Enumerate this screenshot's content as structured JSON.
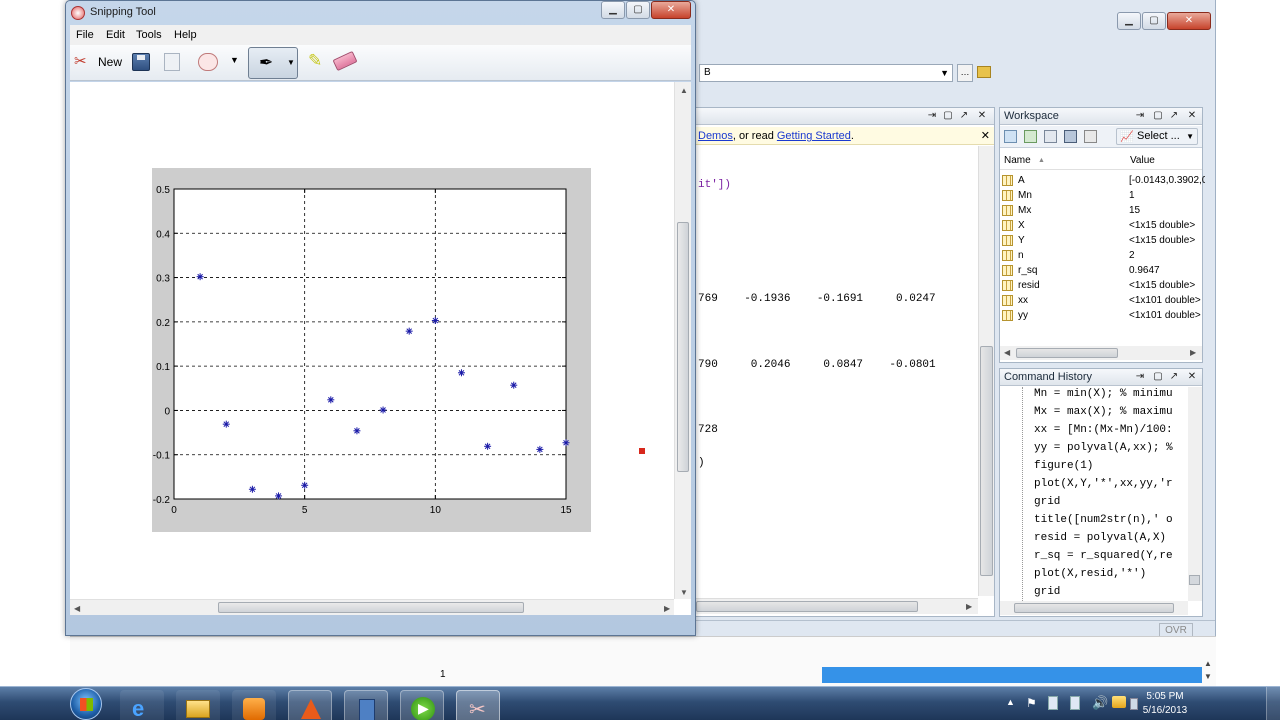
{
  "snipping_tool": {
    "title": "Snipping Tool",
    "menu": [
      "File",
      "Edit",
      "Tools",
      "Help"
    ],
    "new_label": "New",
    "controls": {
      "minimize": "▁",
      "maximize": "▢",
      "close": "✕"
    }
  },
  "chart_data": {
    "type": "scatter",
    "title": "",
    "xlabel": "",
    "ylabel": "",
    "xlim": [
      0,
      15
    ],
    "ylim": [
      -0.2,
      0.5
    ],
    "xticks": [
      "0",
      "5",
      "10",
      "15"
    ],
    "yticks": [
      "0.5",
      "0.4",
      "0.3",
      "0.2",
      "0.1",
      "0",
      "-0.1",
      "-0.2"
    ],
    "grid": true,
    "marker": "*",
    "marker_color": "#1a1aa8",
    "x": [
      1,
      2,
      3,
      4,
      5,
      6,
      7,
      8,
      9,
      10,
      11,
      12,
      13,
      14,
      15
    ],
    "y": [
      0.302,
      -0.031,
      -0.178,
      -0.193,
      -0.169,
      0.024,
      -0.046,
      0.001,
      0.179,
      0.203,
      0.085,
      -0.081,
      0.057,
      -0.088,
      -0.073
    ]
  },
  "matlab": {
    "path_dropdown_text": "B",
    "help_bar": {
      "text1": "Demos",
      "text2": ", or read ",
      "text3": "Getting Started",
      "text4": "."
    },
    "command_output": {
      "line_plot": "it'])",
      "row1": "769    -0.1936    -0.1691     0.0247",
      "row2": "790     0.2046     0.0847    -0.0801",
      "row3": "728",
      "row4": ")"
    },
    "workspace": {
      "title": "Workspace",
      "select_label": "Select ...",
      "col_name": "Name",
      "col_value": "Value",
      "rows": [
        {
          "name": "A",
          "value": "[-0.0143,0.3902,0"
        },
        {
          "name": "Mn",
          "value": "1"
        },
        {
          "name": "Mx",
          "value": "15"
        },
        {
          "name": "X",
          "value": "<1x15 double>"
        },
        {
          "name": "Y",
          "value": "<1x15 double>"
        },
        {
          "name": "n",
          "value": "2"
        },
        {
          "name": "r_sq",
          "value": "0.9647"
        },
        {
          "name": "resid",
          "value": "<1x15 double>"
        },
        {
          "name": "xx",
          "value": "<1x101 double>"
        },
        {
          "name": "yy",
          "value": "<1x101 double>"
        }
      ]
    },
    "command_history": {
      "title": "Command History",
      "lines": [
        "Mn = min(X); % minimu",
        "Mx = max(X); % maximu",
        "xx = [Mn:(Mx-Mn)/100:",
        "yy = polyval(A,xx); %",
        "figure(1)",
        "plot(X,Y,'*',xx,yy,'r",
        "grid",
        "title([num2str(n),' o",
        "resid = polyval(A,X)",
        "r_sq = r_squared(Y,re",
        "plot(X,resid,'*')",
        "grid"
      ]
    },
    "status_ovr": "OVR",
    "bottom_number": "1"
  },
  "taskbar": {
    "time": "5:05 PM",
    "date": "5/16/2013"
  }
}
